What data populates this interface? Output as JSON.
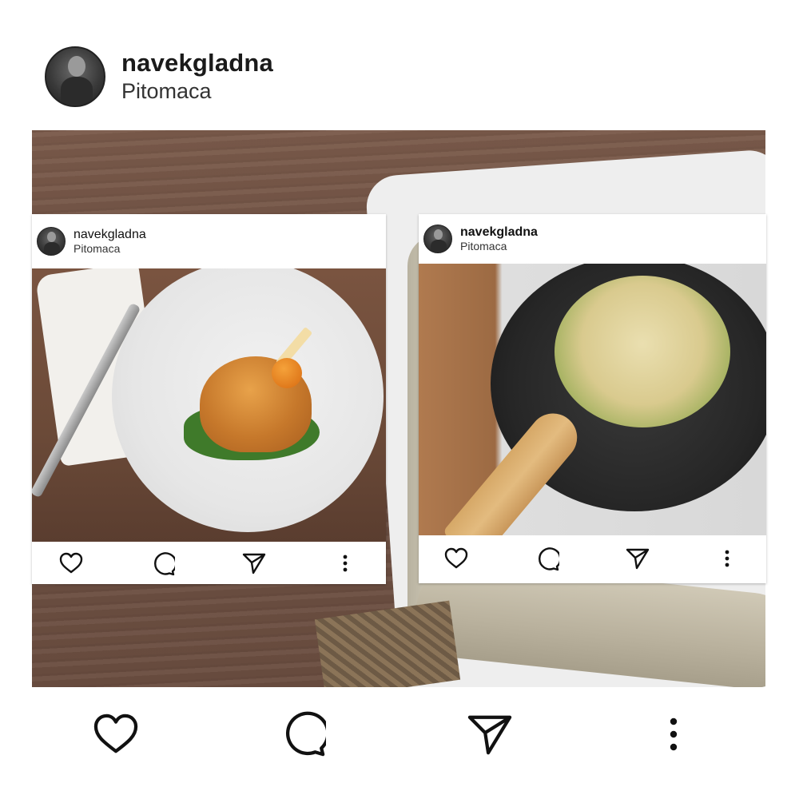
{
  "post": {
    "username": "navekgladna",
    "location": "Pitomaca"
  },
  "embedded_posts": [
    {
      "username": "navekgladna",
      "location": "Pitomaca"
    },
    {
      "username": "navekgladna",
      "location": "Pitomaca"
    }
  ],
  "icons": [
    "heart-icon",
    "comment-icon",
    "share-icon",
    "more-options-icon"
  ]
}
